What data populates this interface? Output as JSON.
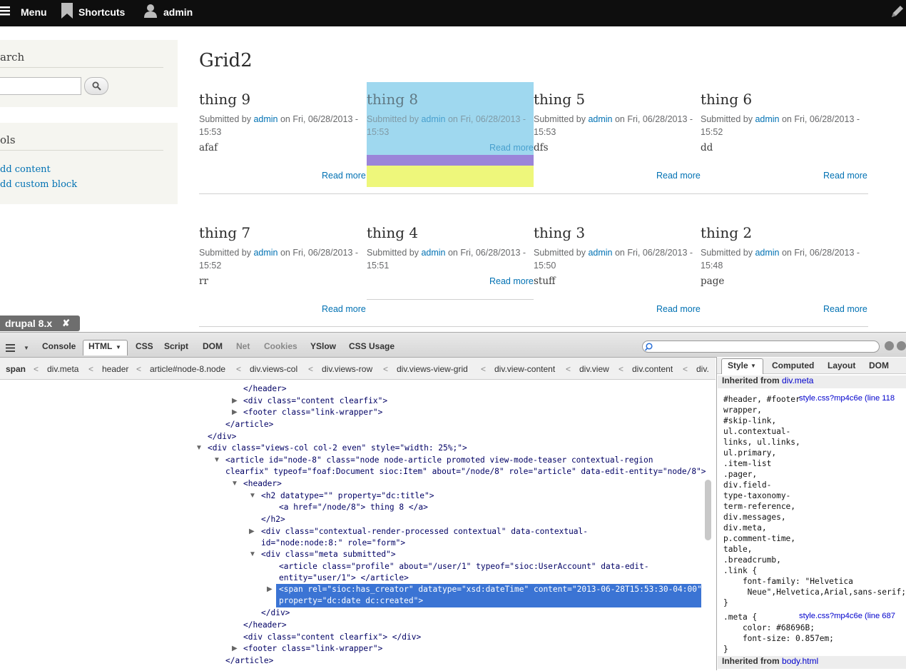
{
  "toolbar": {
    "menu": "Menu",
    "shortcuts": "Shortcuts",
    "user": "admin"
  },
  "sidebar": {
    "search_title": "arch",
    "tools_title": "ols",
    "links": [
      "dd content",
      "dd custom block"
    ]
  },
  "page": {
    "title": "Grid2"
  },
  "grid": [
    {
      "title": "thing 9",
      "prefix": "Submitted by ",
      "author": "admin",
      "date": " on Fri, 06/28/2013 - 15:53",
      "body": "afaf",
      "more": "Read more"
    },
    {
      "title": "thing 8",
      "prefix": "Submitted by ",
      "author": "admin",
      "date": " on Fri, 06/28/2013 - 15:53",
      "body": "",
      "more": "Read more"
    },
    {
      "title": "thing 5",
      "prefix": "Submitted by ",
      "author": "admin",
      "date": " on Fri, 06/28/2013 - 15:53",
      "body": "dfs",
      "more": "Read more"
    },
    {
      "title": "thing 6",
      "prefix": "Submitted by ",
      "author": "admin",
      "date": " on Fri, 06/28/2013 - 15:52",
      "body": "dd",
      "more": "Read more"
    },
    {
      "title": "thing 7",
      "prefix": "Submitted by ",
      "author": "admin",
      "date": " on Fri, 06/28/2013 - 15:52",
      "body": "rr",
      "more": "Read more"
    },
    {
      "title": "thing 4",
      "prefix": "Submitted by ",
      "author": "admin",
      "date": " on Fri, 06/28/2013 - 15:51",
      "body": "",
      "more": "Read more"
    },
    {
      "title": "thing 3",
      "prefix": "Submitted by ",
      "author": "admin",
      "date": " on Fri, 06/28/2013 - 15:50",
      "body": "stuff",
      "more": "Read more"
    },
    {
      "title": "thing 2",
      "prefix": "Submitted by ",
      "author": "admin",
      "date": " on Fri, 06/28/2013 - 15:48",
      "body": "page",
      "more": "Read more"
    }
  ],
  "drupal_tag": {
    "label": "drupal 8.x",
    "close": "✘"
  },
  "firebug": {
    "tabs": [
      "Console",
      "HTML",
      "CSS",
      "Script",
      "DOM",
      "Net",
      "Cookies",
      "YSlow",
      "CSS Usage"
    ],
    "breadcrumbs": [
      "span",
      "div.meta",
      "header",
      "article#node-8.node",
      "div.views-col",
      "div.views-row",
      "div.views-view-grid",
      "div.view-content",
      "div.view",
      "div.content",
      "div."
    ],
    "code": [
      "</header>",
      "<div class=\"content clearfix\">",
      "<footer class=\"link-wrapper\">",
      "</article>",
      "</div>",
      "<div class=\"views-col col-2 even\" style=\"width: 25%;\">",
      "<article id=\"node-8\" class=\"node node-article promoted view-mode-teaser contextual-region",
      "clearfix\" typeof=\"foaf:Document sioc:Item\" about=\"/node/8\" role=\"article\" data-edit-entity=\"node/8\">",
      "<header>",
      "<h2 datatype=\"\" property=\"dc:title\">",
      "<a href=\"/node/8\"> thing 8 </a>",
      "</h2>",
      "<div class=\"contextual-render-processed contextual\" data-contextual-",
      "id=\"node:node:8:\" role=\"form\">",
      "<div class=\"meta submitted\">",
      "<article class=\"profile\" about=\"/user/1\" typeof=\"sioc:UserAccount\" data-edit-",
      "entity=\"user/1\"> </article>",
      "<span rel=\"sioc:has_creator\" datatype=\"xsd:dateTime\" content=\"2013-06-28T15:53:30-04:00\"",
      "property=\"dc:date dc:created\">",
      "</div>",
      "</header>",
      "<div class=\"content clearfix\"> </div>",
      "<footer class=\"link-wrapper\">",
      "</article>"
    ],
    "side_tabs": [
      "Style",
      "Computed",
      "Layout",
      "DOM"
    ],
    "inherited1_prefix": "Inherited from ",
    "inherited1_target": "div.meta",
    "rule1_lines": [
      "#header, #footer",
      "wrapper,",
      "#skip-link,",
      "ul.contextual-",
      "links, ul.links,",
      "ul.primary,",
      ".item-list",
      ".pager,",
      "div.field-",
      "type-taxonomy-",
      "term-reference,",
      "div.messages,",
      "div.meta,",
      "p.comment-time,",
      "table,",
      ".breadcrumb,",
      ".link {",
      "    font-family: \"Helvetica",
      "     Neue\",Helvetica,Arial,sans-serif;",
      "}"
    ],
    "rule1_source": "style.css?mp4c6e (line 118",
    "rule2_lines": [
      ".meta {",
      "    color: #68696B;",
      "    font-size: 0.857em;",
      "}"
    ],
    "rule2_source": "style.css?mp4c6e (line 687",
    "inherited2_prefix": "Inherited from ",
    "inherited2_target": "body.html"
  }
}
